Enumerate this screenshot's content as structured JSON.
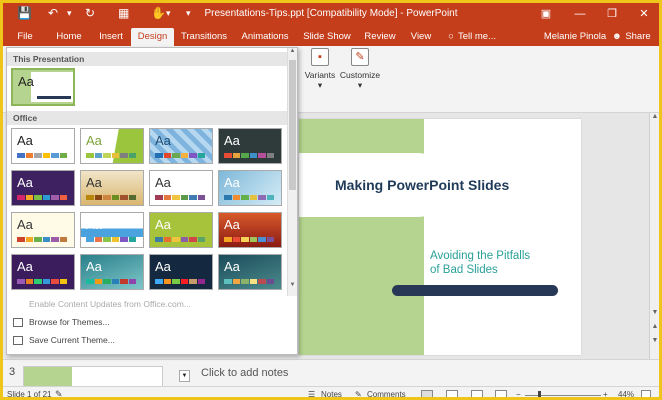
{
  "titlebar": {
    "title": "Presentations-Tips.ppt [Compatibility Mode] - PowerPoint",
    "qat": [
      "save-icon",
      "undo-icon",
      "redo-icon",
      "present-icon",
      "touch-mode-icon",
      "customize-icon"
    ]
  },
  "tabs": [
    "File",
    "Home",
    "Insert",
    "Design",
    "Transitions",
    "Animations",
    "Slide Show",
    "Review",
    "View",
    "Tell me...",
    "Melanie Pinola",
    "Share"
  ],
  "ribbon": {
    "variants_label": "Variants",
    "customize_label": "Customize"
  },
  "gallery": {
    "this_presentation_header": "This Presentation",
    "office_header": "Office",
    "theme_sample_text": "Aa",
    "actions": [
      "Enable Content Updates from Office.com...",
      "Browse for Themes...",
      "Save Current Theme..."
    ]
  },
  "slide": {
    "title": "Making PowerPoint Slides",
    "subtitle_line1": "Avoiding the Pitfalls",
    "subtitle_line2": "of Bad Slides"
  },
  "notes": {
    "thumbnail_number": "3",
    "placeholder": "Click to add notes"
  },
  "status": {
    "slide_info": "Slide 1 of 21",
    "notes_label": "Notes",
    "comments_label": "Comments",
    "zoom": "44%"
  },
  "colors": {
    "accent": "#c43e1c",
    "highlight_border": "#f0c51a"
  }
}
